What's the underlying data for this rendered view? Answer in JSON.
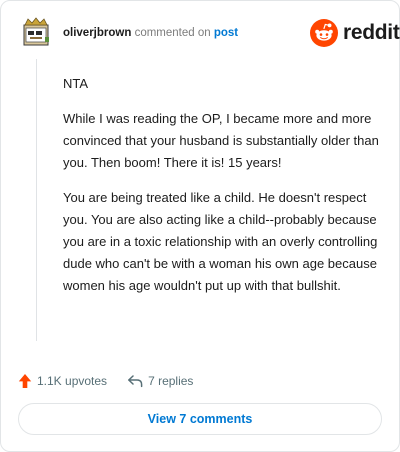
{
  "header": {
    "username": "oliverjbrown",
    "action": "commented on",
    "post_link": "post",
    "brand": "reddit"
  },
  "comment": {
    "paragraphs": [
      "NTA",
      "While I was reading the OP, I became more and more convinced that your husband is substantially older than you. Then boom! There it is! 15 years!",
      "You are being treated like a child. He doesn't respect you. You are also acting like a child--probably because you are in a toxic relationship with an overly controlling dude who can't be with a woman his own age because women his age wouldn't put up with that bullshit."
    ]
  },
  "footer": {
    "upvotes": "1.1K upvotes",
    "replies": "7 replies",
    "view_comments": "View 7 comments"
  },
  "icons": {
    "upvote": "arrow-up-icon",
    "reply": "reply-arrow-icon",
    "logo": "reddit-snoo-icon"
  },
  "colors": {
    "brand": "#ff4500",
    "link": "#0079d3",
    "muted": "#576f76",
    "text": "#1c1c1c"
  }
}
